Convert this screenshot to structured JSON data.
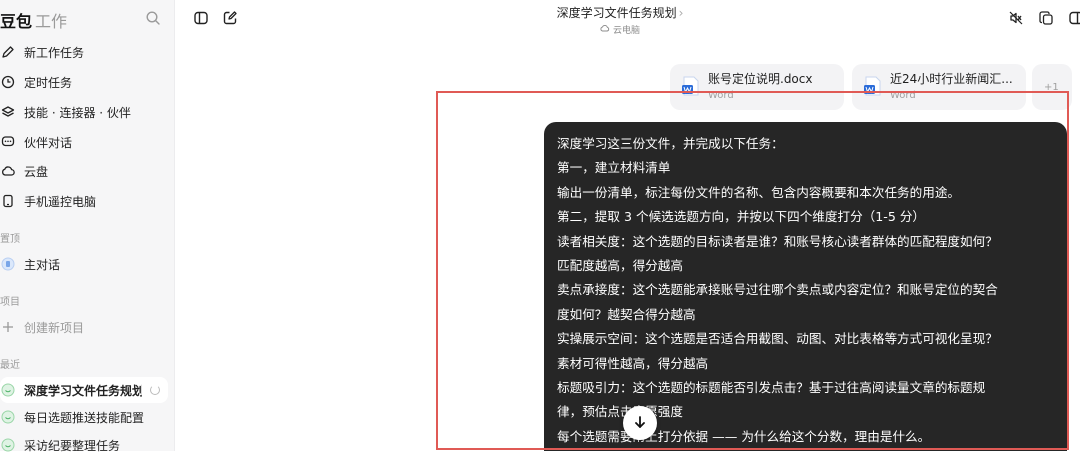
{
  "sidebar": {
    "brand": "豆包",
    "brand_sub": "工作",
    "nav": [
      {
        "label": "新工作任务",
        "icon": "edit-icon"
      },
      {
        "label": "定时任务",
        "icon": "clock-icon"
      },
      {
        "label": "技能 · 连接器 · 伙伴",
        "icon": "layers-icon"
      },
      {
        "label": "伙伴对话",
        "icon": "chat-bubble-icon"
      },
      {
        "label": "云盘",
        "icon": "cloud-icon"
      },
      {
        "label": "手机遥控电脑",
        "icon": "phone-icon"
      }
    ],
    "pinned_label": "置顶",
    "pinned_item": "主对话",
    "projects_label": "项目",
    "new_project": "创建新项目",
    "recent_label": "最近",
    "recent": [
      "深度学习文件任务规划",
      "每日选题推送技能配置",
      "采访纪要整理任务"
    ]
  },
  "header": {
    "title": "深度学习文件任务规划",
    "title_chevron": "›",
    "location": "云电脑"
  },
  "attachments": [
    {
      "name": "账号定位说明.docx",
      "type": "Word"
    },
    {
      "name": "近24小时行业新闻汇...",
      "type": "Word"
    }
  ],
  "attachments_more": "+1",
  "message": {
    "lines": [
      "深度学习这三份文件，并完成以下任务：",
      "第一，建立材料清单",
      "输出一份清单，标注每份文件的名称、包含内容概要和本次任务的用途。",
      "第二，提取 3 个候选选题方向，并按以下四个维度打分（1-5 分）",
      "读者相关度：这个选题的目标读者是谁？和账号核心读者群体的匹配程度如何？",
      "匹配度越高，得分越高",
      "卖点承接度：这个选题能承接账号过往哪个卖点或内容定位？和账号定位的契合",
      "度如何？越契合得分越高",
      "实操展示空间：这个选题是否适合用截图、动图、对比表格等方式可视化呈现？",
      "素材可得性越高，得分越高",
      "标题吸引力：这个选题的标题能否引发点击？基于过往高阅读量文章的标题规",
      "律，预估点击意愿强度",
      "每个选题需要附上打分依据 —— 为什么给这个分数，理由是什么。"
    ]
  },
  "colors": {
    "bubble_bg": "#262626",
    "highlight": "#e05a55",
    "sidebar_bg": "#f6f6f7",
    "word_blue": "#2b6cd9"
  }
}
